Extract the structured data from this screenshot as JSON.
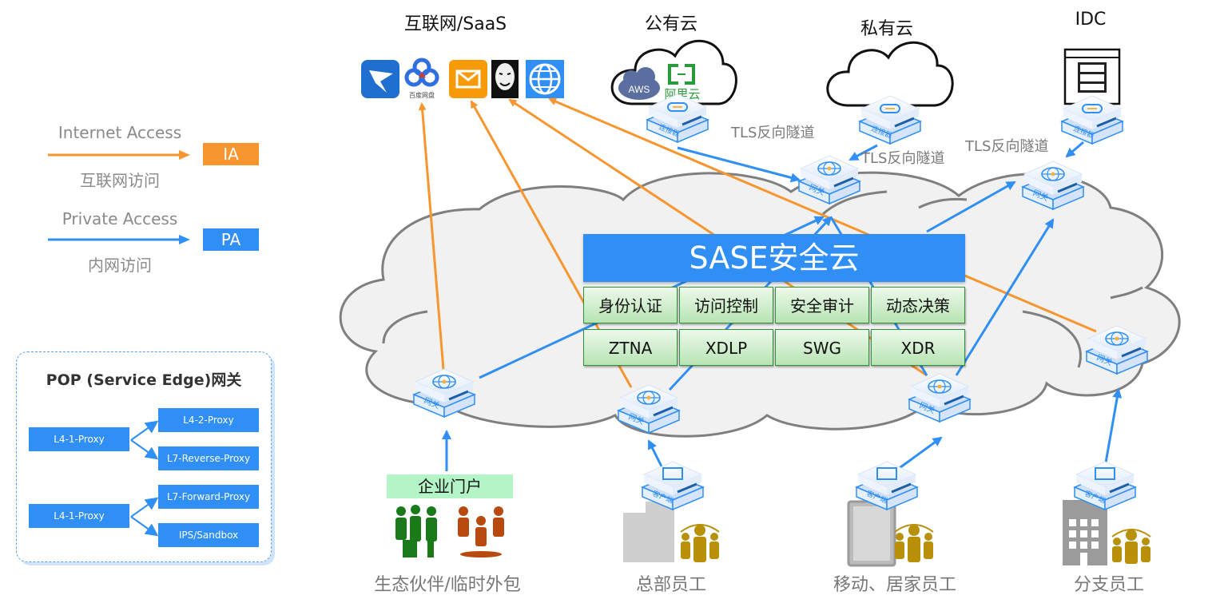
{
  "legend": {
    "internet_access": {
      "label_en": "Internet Access",
      "label_cn": "互联网访问",
      "badge": "IA",
      "color": "#f7952f"
    },
    "private_access": {
      "label_en": "Private Access",
      "label_cn": "内网访问",
      "badge": "PA",
      "color": "#2f8ff5"
    }
  },
  "pop_gateway": {
    "title": "POP (Service Edge)网关",
    "groups": [
      {
        "source": "L4-1-Proxy",
        "targets": [
          "L4-2-Proxy",
          "L7-Reverse-Proxy"
        ]
      },
      {
        "source": "L4-1-Proxy",
        "targets": [
          "L7-Forward-Proxy",
          "IPS/Sandbox"
        ]
      }
    ]
  },
  "resources": {
    "saas": {
      "title": "互联网/SaaS",
      "icons": [
        "dingtalk-icon",
        "baidu-netdisk-icon",
        "mail-icon",
        "anonymous-mask-icon",
        "globe-icon"
      ],
      "baidu_caption": "百度网盘"
    },
    "public_cloud": {
      "title": "公有云",
      "providers": [
        "AWS",
        "阿里云"
      ]
    },
    "private_cloud": {
      "title": "私有云"
    },
    "idc": {
      "title": "IDC"
    }
  },
  "connector_label": "连接器",
  "gateway_label": "网关",
  "client_label": "客户端",
  "tunnel_label": "TLS反向隧道",
  "sase": {
    "title": "SASE安全云",
    "capabilities": [
      "身份认证",
      "访问控制",
      "安全审计",
      "动态决策"
    ],
    "services": [
      "ZTNA",
      "XDLP",
      "SWG",
      "XDR"
    ]
  },
  "users": {
    "portal_label": "企业门户",
    "groups": [
      "生态伙伴/临时外包",
      "总部员工",
      "移动、居家员工",
      "分支员工"
    ]
  },
  "colors": {
    "ia": "#f7952f",
    "pa": "#2f8ff5",
    "cloud_fill": "#f1f1f1",
    "cloud_stroke": "#7f7f7f",
    "capability_border": "#2f8f3a",
    "people_gold": "#b8900a",
    "people_green": "#1a7a1a",
    "people_orange": "#b84a10"
  }
}
